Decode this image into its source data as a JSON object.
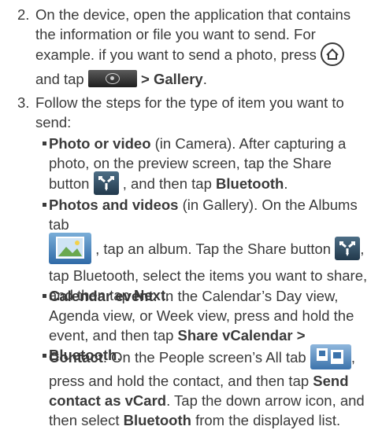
{
  "step2": {
    "number": "2.",
    "line1": "On the device, open the application that contains",
    "line2": "the information or file you want to send. For",
    "line3_pre": "example. if you want to send a photo, press",
    "line4_and_tap": "and tap",
    "gt": ">",
    "gallery": "Gallery",
    "period": "."
  },
  "step3": {
    "number": "3.",
    "line1": "Follow the steps for the type of item you want to",
    "line2": "send:"
  },
  "bullets": {
    "photo_video": {
      "title": "Photo or video",
      "l1": "(in Camera). After capturing a",
      "l2": "photo, on the preview screen, tap the Share",
      "l3_a": "button",
      "l3_b": ", and then tap",
      "bluetooth": "Bluetooth",
      "period": "."
    },
    "photos_videos": {
      "title": "Photos and videos",
      "l1": "(in Gallery). On the Albums tab",
      "l2_a": ", tap an album. Tap the Share button",
      "l2_b": ",",
      "l3": "tap Bluetooth, select the items you want to share,",
      "l4_a": "and then tap",
      "next": "Next",
      "period": "."
    },
    "calendar": {
      "title": "Calendar event",
      "l1": ". In the Calendar’s Day view,",
      "l2": "Agenda view, or Week view, press and hold the",
      "l3_a": "event, and then tap",
      "share_vcal": "Share vCalendar",
      "gt": ">",
      "bluetooth": "Bluetooth",
      "period": "."
    },
    "contact": {
      "title": "Contact",
      "l1": ". On the People screen’s All tab",
      "l1_end": ",",
      "l2_a": "press and hold the contact, and then tap",
      "send": "Send",
      "contact_vcard": "contact as vCard",
      "l3": ". Tap the down arrow icon, and",
      "l4_a": "then select",
      "bluetooth": "Bluetooth",
      "l4_b": "from the displayed list."
    }
  }
}
